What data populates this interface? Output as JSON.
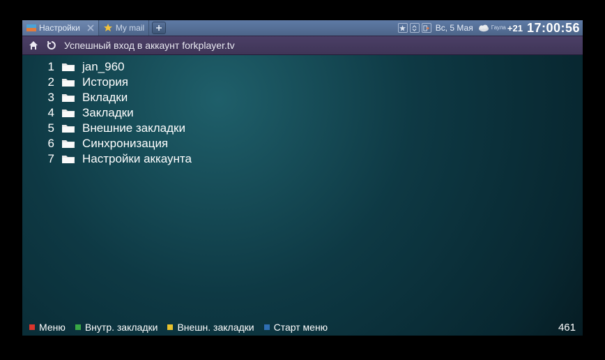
{
  "tabs": [
    {
      "label": "Настройки",
      "active": true
    },
    {
      "label": "My mail",
      "active": false
    }
  ],
  "status": {
    "date": "Вс, 5 Мая",
    "location": "Гаула",
    "temp": "+21",
    "time": "17:00:56"
  },
  "addressbar": {
    "message": "Успешный вход в аккаунт forkplayer.tv"
  },
  "list": [
    {
      "n": "1",
      "label": "jan_960"
    },
    {
      "n": "2",
      "label": "История"
    },
    {
      "n": "3",
      "label": "Вкладки"
    },
    {
      "n": "4",
      "label": "Закладки"
    },
    {
      "n": "5",
      "label": "Внешние закладки"
    },
    {
      "n": "6",
      "label": "Синхронизация"
    },
    {
      "n": "7",
      "label": "Настройки аккаунта"
    }
  ],
  "footer": {
    "red": "Меню",
    "green": "Внутр. закладки",
    "yellow": "Внешн. закладки",
    "blue": "Старт меню",
    "count": "461"
  }
}
